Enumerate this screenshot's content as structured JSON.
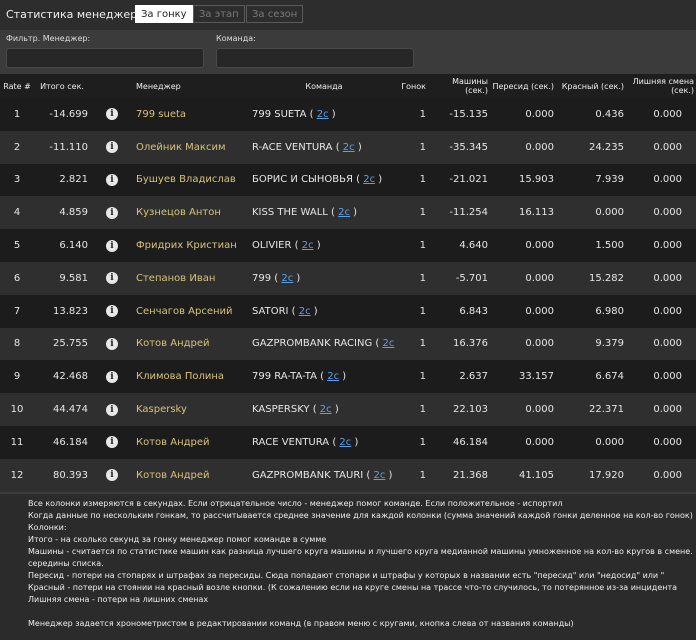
{
  "header": {
    "title": "Статистика менеджеров",
    "tabs": [
      {
        "label": "За гонку",
        "active": true
      },
      {
        "label": "За этап",
        "active": false
      },
      {
        "label": "За сезон",
        "active": false
      }
    ]
  },
  "filters": {
    "manager_label": "Фильтр. Менеджер:",
    "team_label": "Команда:",
    "manager_value": "",
    "team_value": ""
  },
  "table": {
    "columns": [
      "Rate #",
      "Итого сек.",
      "",
      "Менеджер",
      "Команда",
      "Гонок",
      "Машины (сек.)",
      "Пересид (сек.)",
      "Красный (сек.)",
      "Лишняя смена (сек.)"
    ],
    "rows": [
      {
        "rate": "1",
        "total": "-14.699",
        "manager": "799 sueta",
        "team": "799 SUETA (",
        "link": "2c",
        "close": " )",
        "races": "1",
        "cars": "-15.135",
        "pit": "0.000",
        "red": "0.436",
        "extra": "0.000"
      },
      {
        "rate": "2",
        "total": "-11.110",
        "manager": "Олейник Максим",
        "team": "R-ACE VENTURA (",
        "link": "2c",
        "close": " )",
        "races": "1",
        "cars": "-35.345",
        "pit": "0.000",
        "red": "24.235",
        "extra": "0.000"
      },
      {
        "rate": "3",
        "total": "2.821",
        "manager": "Бушуев Владислав",
        "team": "БОРИС И СЫНОВЬЯ (",
        "link": "2c",
        "close": " )",
        "races": "1",
        "cars": "-21.021",
        "pit": "15.903",
        "red": "7.939",
        "extra": "0.000"
      },
      {
        "rate": "4",
        "total": "4.859",
        "manager": "Кузнецов Антон",
        "team": "KISS THE WALL (",
        "link": "2c",
        "close": " )",
        "races": "1",
        "cars": "-11.254",
        "pit": "16.113",
        "red": "0.000",
        "extra": "0.000"
      },
      {
        "rate": "5",
        "total": "6.140",
        "manager": "Фридрих Кристиан",
        "team": "OLIVIER (",
        "link": "2c",
        "close": " )",
        "races": "1",
        "cars": "4.640",
        "pit": "0.000",
        "red": "1.500",
        "extra": "0.000"
      },
      {
        "rate": "6",
        "total": "9.581",
        "manager": "Степанов Иван",
        "team": "799 (",
        "link": "2c",
        "close": " )",
        "races": "1",
        "cars": "-5.701",
        "pit": "0.000",
        "red": "15.282",
        "extra": "0.000"
      },
      {
        "rate": "7",
        "total": "13.823",
        "manager": "Сенчагов Арсений",
        "team": "SATORI (",
        "link": "2c",
        "close": " )",
        "races": "1",
        "cars": "6.843",
        "pit": "0.000",
        "red": "6.980",
        "extra": "0.000"
      },
      {
        "rate": "8",
        "total": "25.755",
        "manager": "Котов Андрей",
        "team": "GAZPROMBANK RACING (",
        "link": "2c",
        "close": " )",
        "races": "1",
        "cars": "16.376",
        "pit": "0.000",
        "red": "9.379",
        "extra": "0.000"
      },
      {
        "rate": "9",
        "total": "42.468",
        "manager": "Климова Полина",
        "team": "799 RA-TA-TA (",
        "link": "2c",
        "close": " )",
        "races": "1",
        "cars": "2.637",
        "pit": "33.157",
        "red": "6.674",
        "extra": "0.000"
      },
      {
        "rate": "10",
        "total": "44.474",
        "manager": "Kaspersky",
        "team": "KASPERSKY (",
        "link": "2c",
        "close": " )",
        "races": "1",
        "cars": "22.103",
        "pit": "0.000",
        "red": "22.371",
        "extra": "0.000"
      },
      {
        "rate": "11",
        "total": "46.184",
        "manager": "Котов Андрей",
        "team": "RACE VENTURA (",
        "link": "2c",
        "close": " )",
        "races": "1",
        "cars": "46.184",
        "pit": "0.000",
        "red": "0.000",
        "extra": "0.000"
      },
      {
        "rate": "12",
        "total": "80.393",
        "manager": "Котов Андрей",
        "team": "GAZPROMBANK TAURI (",
        "link": "2c",
        "close": " )",
        "races": "1",
        "cars": "21.368",
        "pit": "41.105",
        "red": "17.920",
        "extra": "0.000"
      }
    ]
  },
  "notes": [
    "Все колонки измеряются в секундах. Если отрицательное число - менеджер помог команде. Если положительное - испортил",
    "Когда данные по нескольким гонкам, то рассчитывается среднее значение для каждой колонки (сумма значений каждой гонки деленное на кол-во гонок)",
    "Колонки:",
    "Итого - на сколько секунд за гонку менеджер помог команде в сумме",
    "Машины - считается по статистике машин как разница лучшего круга машины и лучшего круга медианной машины умноженное на кол-во кругов в смене.",
    "середины списка.",
    "Пересид - потери на стопарях и штрафах за пересиды. Сюда попадают стопари и штрафы у которых в названии есть \"пересид\" или \"недосид\" или \"",
    "Красный - потери на стоянии на красный возле кнопки. (К сожалению если на круге смены на трассе что-то случилось, то потерянное из-за инцидента",
    "Лишняя смена - потери на лишних сменах",
    "",
    "Менеджер задается хронометристом в редактировании команд (в правом меню с кругами, кнопка слева от названия команды)"
  ]
}
